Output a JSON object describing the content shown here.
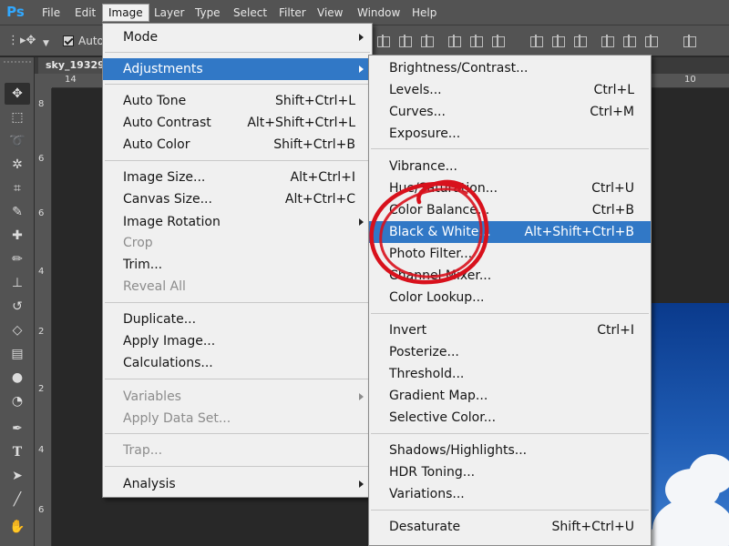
{
  "app": {
    "logo": "Ps"
  },
  "menubar": {
    "items": [
      "File",
      "Edit",
      "Image",
      "Layer",
      "Type",
      "Select",
      "Filter",
      "View",
      "Window",
      "Help"
    ],
    "active": "Image"
  },
  "options_bar": {
    "auto_label": "Auto",
    "auto_checked": true
  },
  "document": {
    "tab_title": "sky_19329"
  },
  "rulers": {
    "top": [
      "14",
      "10"
    ],
    "left": [
      "8",
      "6",
      "6",
      "4",
      "2",
      "2",
      "4",
      "6"
    ]
  },
  "tools": [
    "move-tool",
    "marquee-tool",
    "lasso-tool",
    "magic-wand-tool",
    "crop-tool",
    "eyedropper-tool",
    "healing-brush-tool",
    "brush-tool",
    "clone-stamp-tool",
    "history-brush-tool",
    "eraser-tool",
    "gradient-tool",
    "blur-tool",
    "dodge-tool",
    "pen-tool",
    "type-tool",
    "path-selection-tool",
    "line-tool",
    "hand-tool"
  ],
  "image_menu": {
    "items": [
      {
        "label": "Mode",
        "shortcut": "",
        "submenu": true
      },
      {
        "label": "Adjustments",
        "shortcut": "",
        "submenu": true,
        "highlight": true
      },
      {
        "label": "Auto Tone",
        "shortcut": "Shift+Ctrl+L"
      },
      {
        "label": "Auto Contrast",
        "shortcut": "Alt+Shift+Ctrl+L"
      },
      {
        "label": "Auto Color",
        "shortcut": "Shift+Ctrl+B"
      },
      {
        "label": "Image Size...",
        "shortcut": "Alt+Ctrl+I"
      },
      {
        "label": "Canvas Size...",
        "shortcut": "Alt+Ctrl+C"
      },
      {
        "label": "Image Rotation",
        "shortcut": "",
        "submenu": true
      },
      {
        "label": "Crop",
        "shortcut": "",
        "disabled": true
      },
      {
        "label": "Trim...",
        "shortcut": ""
      },
      {
        "label": "Reveal All",
        "shortcut": "",
        "disabled": true
      },
      {
        "label": "Duplicate...",
        "shortcut": ""
      },
      {
        "label": "Apply Image...",
        "shortcut": ""
      },
      {
        "label": "Calculations...",
        "shortcut": ""
      },
      {
        "label": "Variables",
        "shortcut": "",
        "submenu": true,
        "disabled": true
      },
      {
        "label": "Apply Data Set...",
        "shortcut": "",
        "disabled": true
      },
      {
        "label": "Trap...",
        "shortcut": "",
        "disabled": true
      },
      {
        "label": "Analysis",
        "shortcut": "",
        "submenu": true
      }
    ]
  },
  "adjustments_menu": {
    "items": [
      {
        "label": "Brightness/Contrast...",
        "shortcut": ""
      },
      {
        "label": "Levels...",
        "shortcut": "Ctrl+L"
      },
      {
        "label": "Curves...",
        "shortcut": "Ctrl+M"
      },
      {
        "label": "Exposure...",
        "shortcut": ""
      },
      {
        "label": "Vibrance...",
        "shortcut": ""
      },
      {
        "label": "Hue/Saturation...",
        "shortcut": "Ctrl+U"
      },
      {
        "label": "Color Balance...",
        "shortcut": "Ctrl+B"
      },
      {
        "label": "Black & White...",
        "shortcut": "Alt+Shift+Ctrl+B",
        "highlight": true
      },
      {
        "label": "Photo Filter...",
        "shortcut": ""
      },
      {
        "label": "Channel Mixer...",
        "shortcut": ""
      },
      {
        "label": "Color Lookup...",
        "shortcut": ""
      },
      {
        "label": "Invert",
        "shortcut": "Ctrl+I"
      },
      {
        "label": "Posterize...",
        "shortcut": ""
      },
      {
        "label": "Threshold...",
        "shortcut": ""
      },
      {
        "label": "Gradient Map...",
        "shortcut": ""
      },
      {
        "label": "Selective Color...",
        "shortcut": ""
      },
      {
        "label": "Shadows/Highlights...",
        "shortcut": ""
      },
      {
        "label": "HDR Toning...",
        "shortcut": ""
      },
      {
        "label": "Variations...",
        "shortcut": ""
      },
      {
        "label": "Desaturate",
        "shortcut": "Shift+Ctrl+U"
      }
    ]
  },
  "colors": {
    "ui_panel": "#535353",
    "menu_bg": "#f0f0f0",
    "highlight": "#3178c6",
    "annotation": "#d8111c",
    "sky": "#1f5cb4"
  }
}
